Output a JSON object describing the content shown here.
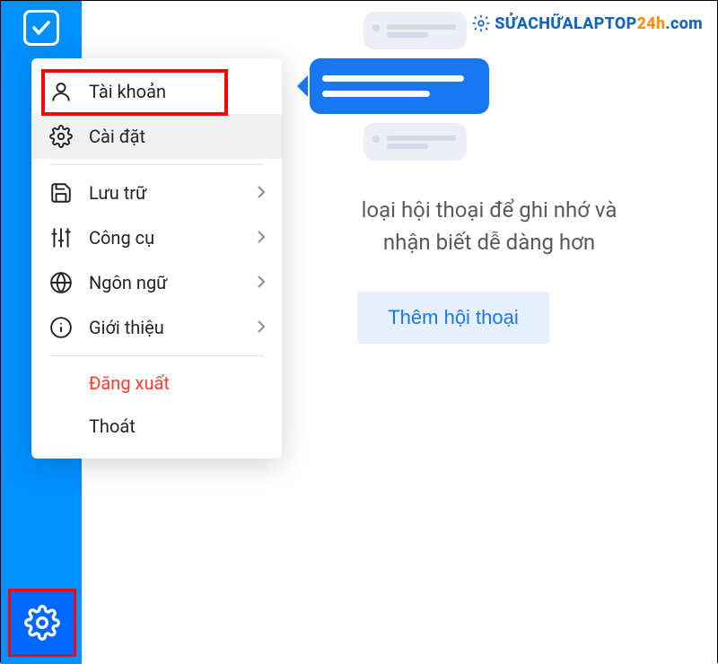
{
  "menu": {
    "account": "Tài khoản",
    "settings": "Cài đặt",
    "storage": "Lưu trữ",
    "tools": "Công cụ",
    "language": "Ngôn ngữ",
    "about": "Giới thiệu",
    "logout": "Đăng xuất",
    "exit": "Thoát"
  },
  "main": {
    "line1": "loại hội thoại để ghi nhớ và",
    "line2": "nhận biết dễ dàng hơn",
    "button": "Thêm hội thoại"
  },
  "watermark": {
    "part1": "SỬACHỮALAPTOP",
    "part2": "24h",
    "part3": ".com"
  }
}
